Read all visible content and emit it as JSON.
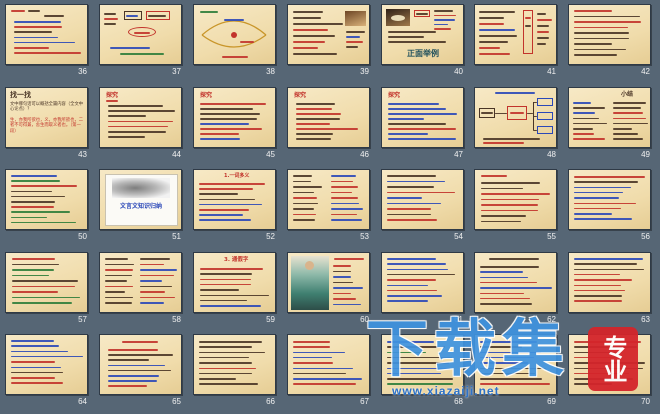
{
  "slides": [
    {
      "number": "36"
    },
    {
      "number": "37"
    },
    {
      "number": "38"
    },
    {
      "number": "39"
    },
    {
      "number": "40",
      "title": "正面举例"
    },
    {
      "number": "41"
    },
    {
      "number": "42"
    },
    {
      "number": "43",
      "title": "找一找",
      "body": "文中哪句话可以概括全篇内容（全文中心论点）？",
      "quote": "生，亦我所欲也，义，亦我所欲也，二者不可得兼，舍生而取义者也。（第一段）"
    },
    {
      "number": "44",
      "title": "探究"
    },
    {
      "number": "45",
      "title": "探究"
    },
    {
      "number": "46",
      "title": "探究"
    },
    {
      "number": "47",
      "title": "探究"
    },
    {
      "number": "48"
    },
    {
      "number": "49",
      "title": "小结"
    },
    {
      "number": "50"
    },
    {
      "number": "51",
      "title": "文言文知识归纳"
    },
    {
      "number": "52",
      "title": "1.一词多义"
    },
    {
      "number": "53"
    },
    {
      "number": "54"
    },
    {
      "number": "55"
    },
    {
      "number": "56"
    },
    {
      "number": "57"
    },
    {
      "number": "58"
    },
    {
      "number": "59",
      "title": "3. 通假字"
    },
    {
      "number": "60"
    },
    {
      "number": "61"
    },
    {
      "number": "62"
    },
    {
      "number": "63"
    },
    {
      "number": "64"
    },
    {
      "number": "65"
    },
    {
      "number": "66"
    },
    {
      "number": "67"
    },
    {
      "number": "68"
    },
    {
      "number": "69"
    },
    {
      "number": "70"
    }
  ],
  "watermark": {
    "brand": "下载集",
    "url": "www.xiazaiji.net",
    "seal": "专业"
  },
  "colors": {
    "background": "#566675",
    "label": "#f0f0f0",
    "ink_dark": "#4a3526",
    "ink_red": "#c2332b",
    "ink_blue": "#2b48b8",
    "ink_green": "#2f7d3a",
    "stamp": "#1e4f5c",
    "watermark_blue": "#3f93e0",
    "watermark_url": "#2d72c8",
    "seal_red": "#d4252b"
  }
}
